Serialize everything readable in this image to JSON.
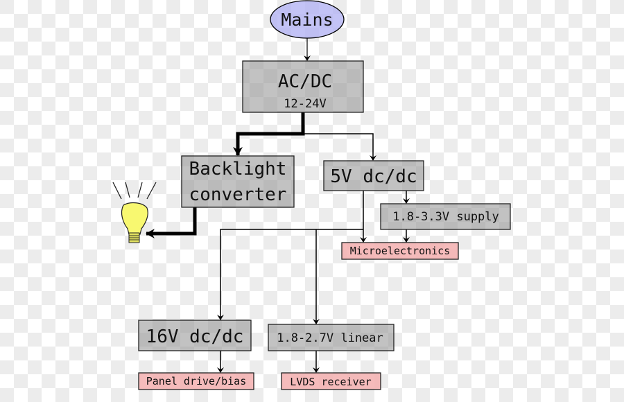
{
  "colors": {
    "mains_fill": "#b4b4f4",
    "block_fill": "#a8a8a8",
    "load_fill": "#f4b4b4",
    "bulb_fill": "#f8f870",
    "checker": "#ececec"
  },
  "nodes": {
    "mains": "Mains",
    "acdc": {
      "title": "AC/DC",
      "subtitle": "12-24V"
    },
    "backlight": {
      "line1": "Backlight",
      "line2": "converter"
    },
    "dcdc5v": "5V dc/dc",
    "supply": "1.8-3.3V supply",
    "micro": "Microelectronics",
    "dcdc16v": "16V dc/dc",
    "linear": "1.8-2.7V linear",
    "panel": "Panel drive/bias",
    "lvds": "LVDS receiver"
  },
  "icons": {
    "lamp": "light-bulb-icon"
  }
}
